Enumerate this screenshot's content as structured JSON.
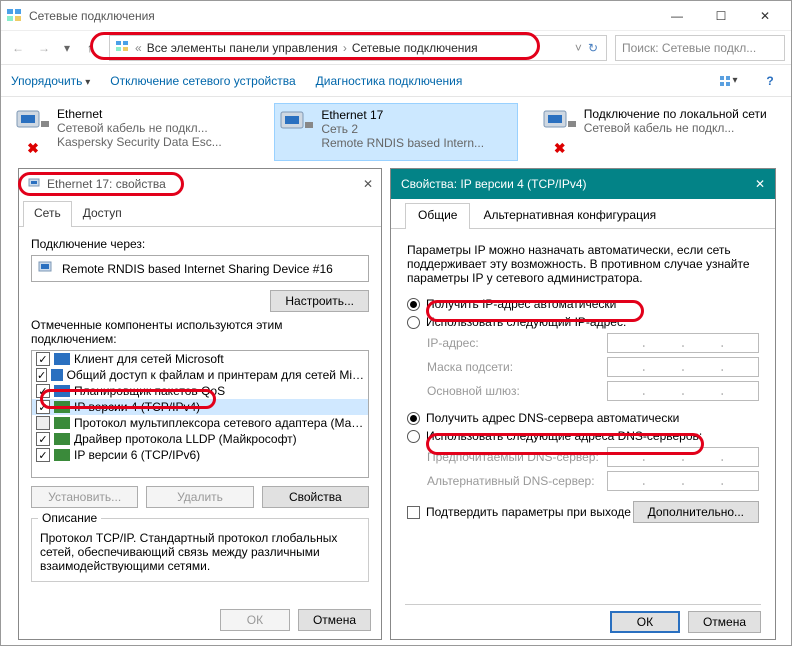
{
  "titlebar": {
    "title": "Сетевые подключения"
  },
  "addressbar": {
    "prefix": "«",
    "seg1": "Все элементы панели управления",
    "seg2": "Сетевые подключения"
  },
  "search": {
    "placeholder": "Поиск: Сетевые подкл..."
  },
  "toolbar": {
    "organize": "Упорядочить",
    "disable": "Отключение сетевого устройства",
    "diag": "Диагностика подключения"
  },
  "conns": [
    {
      "name": "Ethernet",
      "l2": "Сетевой кабель не подкл...",
      "l3": "Kaspersky Security Data Esc...",
      "redx": true
    },
    {
      "name": "Ethernet 17",
      "l2": "Сеть 2",
      "l3": "Remote RNDIS based Intern...",
      "redx": false
    },
    {
      "name": "Подключение по локальной сети",
      "l2": "Сетевой кабель не подкл...",
      "l3": "",
      "redx": true
    }
  ],
  "dlg1": {
    "title": "Ethernet 17: свойства",
    "tab_net": "Сеть",
    "tab_access": "Доступ",
    "conn_via": "Подключение через:",
    "adapter": "Remote RNDIS based Internet Sharing Device #16",
    "configure": "Настроить...",
    "components_label": "Отмеченные компоненты используются этим подключением:",
    "components": [
      "Клиент для сетей Microsoft",
      "Общий доступ к файлам и принтерам для сетей Mi…",
      "Планировщик пакетов QoS",
      "IP версии 4 (TCP/IPv4)",
      "Протокол мультиплексора сетевого адаптера (Ма…",
      "Драйвер протокола LLDP (Майкрософт)",
      "IP версии 6 (TCP/IPv6)"
    ],
    "install": "Установить...",
    "remove": "Удалить",
    "props": "Свойства",
    "desc_title": "Описание",
    "desc": "Протокол TCP/IP. Стандартный протокол глобальных сетей, обеспечивающий связь между различными взаимодействующими сетями.",
    "ok": "ОК",
    "cancel": "Отмена"
  },
  "dlg2": {
    "title": "Свойства: IP версии 4 (TCP/IPv4)",
    "tab_general": "Общие",
    "tab_alt": "Альтернативная конфигурация",
    "intro": "Параметры IP можно назначать автоматически, если сеть поддерживает эту возможность. В противном случае узнайте параметры IP у сетевого администратора.",
    "r_auto_ip": "Получить IP-адрес автоматически",
    "r_use_ip": "Использовать следующий IP-адрес:",
    "ip": "IP-адрес:",
    "mask": "Маска подсети:",
    "gw": "Основной шлюз:",
    "r_auto_dns": "Получить адрес DNS-сервера автоматически",
    "r_use_dns": "Использовать следующие адреса DNS-серверов:",
    "dns1": "Предпочитаемый DNS-сервер:",
    "dns2": "Альтернативный DNS-сервер:",
    "confirm": "Подтвердить параметры при выходе",
    "advanced": "Дополнительно...",
    "ok": "ОК",
    "cancel": "Отмена"
  }
}
